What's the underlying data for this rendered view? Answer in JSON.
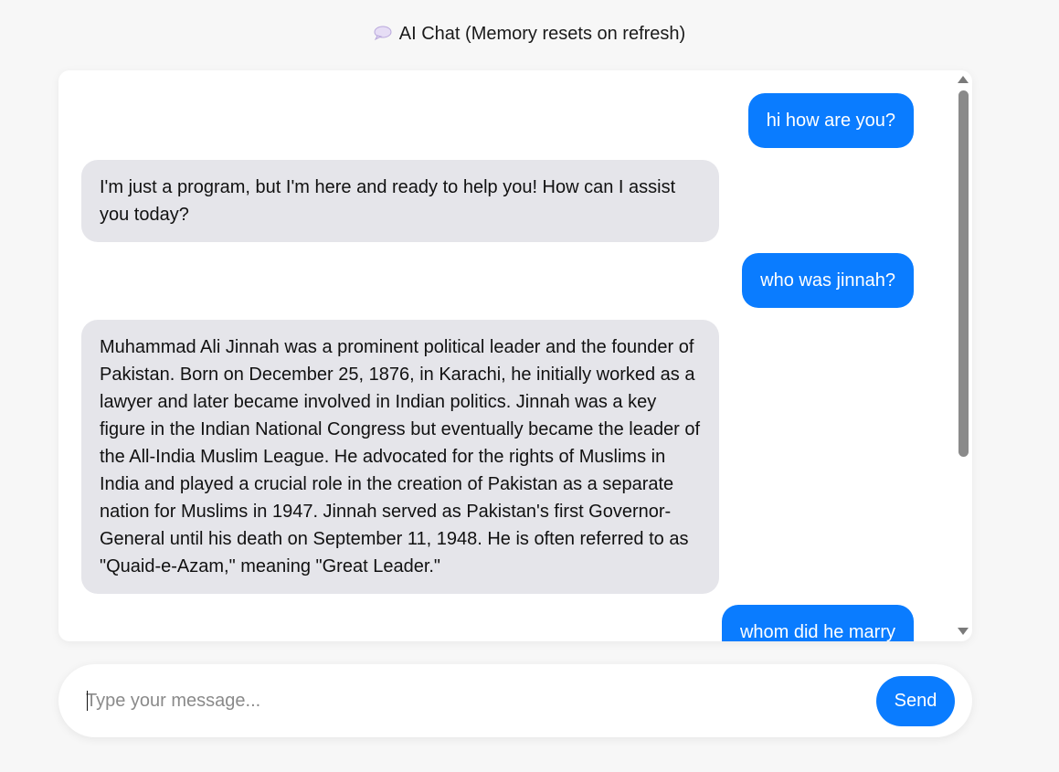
{
  "header": {
    "icon": "speech-bubble-icon",
    "title": "AI Chat (Memory resets on refresh)"
  },
  "colors": {
    "user_bubble": "#0a7cff",
    "bot_bubble": "#e5e5ea",
    "send_button": "#0a7cff",
    "background": "#f7f7f7"
  },
  "messages": [
    {
      "role": "user",
      "text": "hi how are you?"
    },
    {
      "role": "bot",
      "text": "I'm just a program, but I'm here and ready to help you! How can I assist you today?"
    },
    {
      "role": "user",
      "text": "who was jinnah?"
    },
    {
      "role": "bot",
      "text": "Muhammad Ali Jinnah was a prominent political leader and the founder of Pakistan. Born on December 25, 1876, in Karachi, he initially worked as a lawyer and later became involved in Indian politics. Jinnah was a key figure in the Indian National Congress but eventually became the leader of the All-India Muslim League. He advocated for the rights of Muslims in India and played a crucial role in the creation of Pakistan as a separate nation for Muslims in 1947. Jinnah served as Pakistan's first Governor-General until his death on September 11, 1948. He is often referred to as \"Quaid-e-Azam,\" meaning \"Great Leader.\""
    },
    {
      "role": "user",
      "text": "whom did he marry"
    }
  ],
  "input": {
    "placeholder": "Type your message...",
    "value": ""
  },
  "send_label": "Send"
}
